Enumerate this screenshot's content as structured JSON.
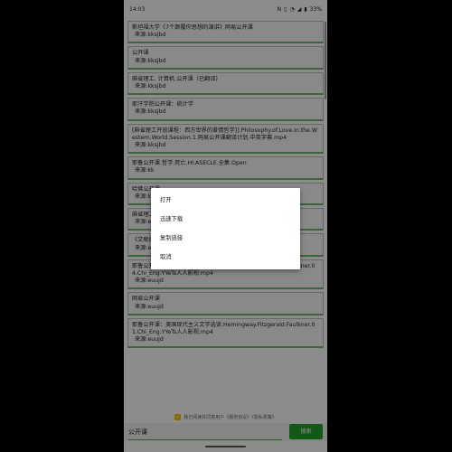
{
  "status_bar": {
    "time": "14:03",
    "battery": "33%",
    "icons": [
      "nfc-icon",
      "vibrate-icon",
      "wifi-icon",
      "signal-icon",
      "battery-icon"
    ]
  },
  "results": [
    {
      "title": "斯坦福大学《7个颠覆你思想的演讲》网易公开课",
      "source": "来源:kksjbd"
    },
    {
      "title": "公开课",
      "source": "来源:kksjbd"
    },
    {
      "title": "麻省理工. 计算机.公开课（已翻译）",
      "source": "来源:kksjbd"
    },
    {
      "title": "耶汗学院公开课：统计学",
      "source": "来源:kksjbd"
    },
    {
      "title": "[麻省理工开放课程：西方世界的爱情哲学]].Philosophy.of.Love.in.the.Western.World.Session.1.网易公开课翻译计划.中英字幕.mp4",
      "source": "来源:kksjbd"
    },
    {
      "title": "耶鲁公开课.哲学.死亡.HI.ASECLE.全集.Open",
      "source": "来源:kk"
    },
    {
      "title": "哈佛公开课",
      "source": "来源:kk"
    },
    {
      "title": "麻省理工",
      "source": "来源:eu"
    },
    {
      "title": "《文献阅读信息分析》网络公开课课件",
      "source": "来源:euujd"
    },
    {
      "title": "耶鲁公开课：美国现代主义文学选读.Hemingway.Fitzgerald.Faulkner.04.Chi_Eng.YYeTs人人影视.mp4",
      "source": "来源:euujd"
    },
    {
      "title": "网易公开课",
      "source": "来源:euujd"
    },
    {
      "title": "耶鲁公开课：美国现代主义文学选读.Hemingway.Fitzgerald.Faulkner.01.Chi_Eng.YYeTs人人影视.mp4",
      "source": "来源:euujd"
    }
  ],
  "agreement": {
    "label": "我已阅读并同意用户《服务协议》《隐私政策》",
    "checked": true
  },
  "search": {
    "value": "公开课",
    "button_label": "搜索"
  },
  "context_menu": {
    "items": [
      "打开",
      "迅速下载",
      "复制链接",
      "取消"
    ]
  },
  "colors": {
    "accent": "#21a32b",
    "underline": "#6fb86f",
    "checkbox": "#f2c400"
  }
}
